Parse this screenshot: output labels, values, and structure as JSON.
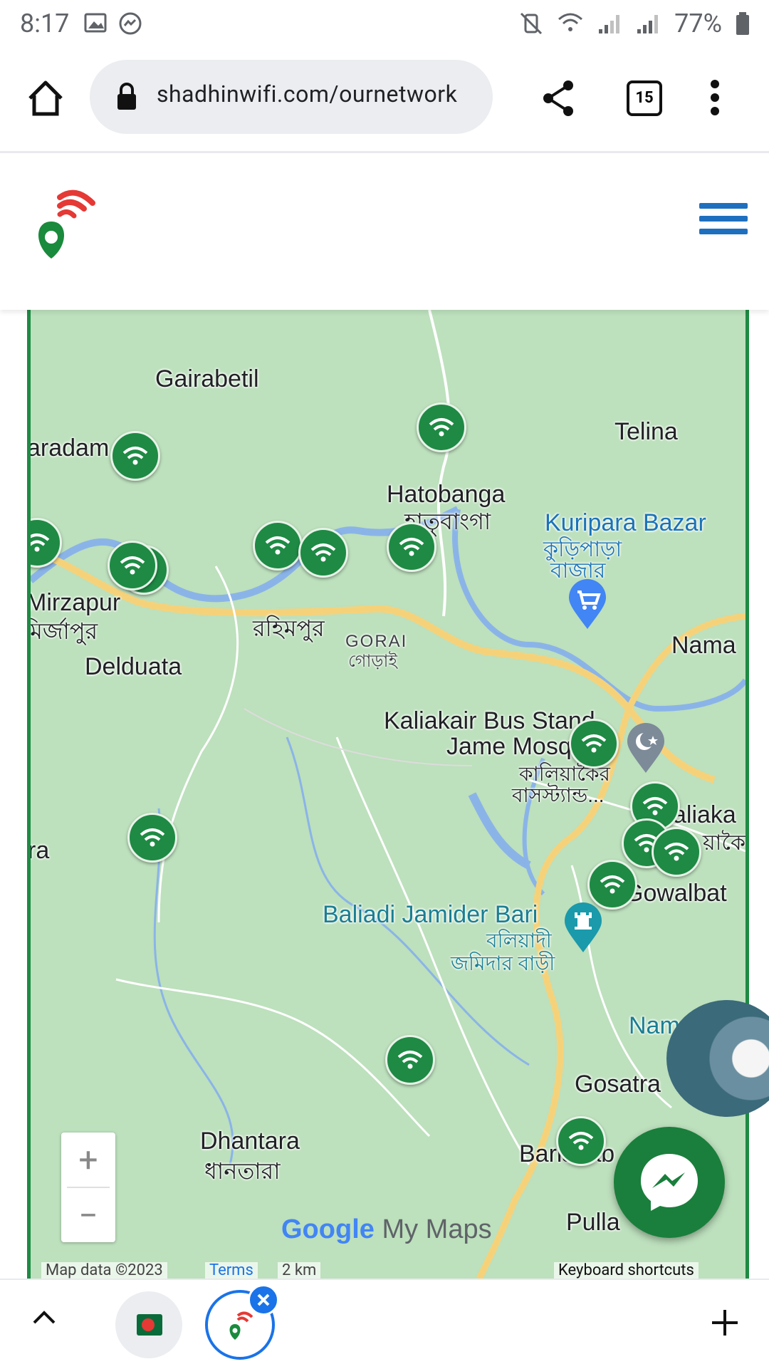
{
  "status_bar": {
    "time": "8:17",
    "battery": "77%"
  },
  "browser": {
    "url": "shadhinwifi.com/ournetwork",
    "tab_count": "15"
  },
  "map": {
    "places": [
      {
        "id": "gairabetil",
        "text": "Gairabetil",
        "style": "dark"
      },
      {
        "id": "telina",
        "text": "Telina",
        "style": "dark"
      },
      {
        "id": "aradam",
        "text": "aradam",
        "style": "dark"
      },
      {
        "id": "hatobanga",
        "text": "Hatobanga",
        "style": "dark"
      },
      {
        "id": "hatobanga_bn",
        "text": "হাতুবাংগা",
        "style": "dark"
      },
      {
        "id": "kuripara",
        "text": "Kuripara Bazar",
        "style": "blue"
      },
      {
        "id": "kuripara_bn1",
        "text": "কুড়িপাড়া",
        "style": "blue"
      },
      {
        "id": "kuripara_bn2",
        "text": "বাজার",
        "style": "blue"
      },
      {
        "id": "mirzapur",
        "text": "Mirzapur",
        "style": "dark"
      },
      {
        "id": "mirzapur_bn",
        "text": "মির্জাপুর",
        "style": "dark"
      },
      {
        "id": "rahimpur_bn",
        "text": "রহিমপুর",
        "style": "dark"
      },
      {
        "id": "goral",
        "text": "GORAI",
        "style": "small"
      },
      {
        "id": "goral_bn",
        "text": "গোড়াই",
        "style": "small"
      },
      {
        "id": "nama",
        "text": "Nama",
        "style": "dark"
      },
      {
        "id": "delduata",
        "text": "Delduata",
        "style": "dark"
      },
      {
        "id": "kaliakair1",
        "text": "Kaliakair Bus Stand",
        "style": "dark"
      },
      {
        "id": "kaliakair2",
        "text": "Jame Mosque",
        "style": "dark"
      },
      {
        "id": "kaliakair_bn1",
        "text": "কালিয়াকৈর",
        "style": "dark"
      },
      {
        "id": "kaliakair_bn2",
        "text": "বাসস্ট্যান্ড...",
        "style": "dark"
      },
      {
        "id": "kaliaka",
        "text": "aliaka",
        "style": "dark"
      },
      {
        "id": "kaliaka_bn",
        "text": "য়াকৈ",
        "style": "dark"
      },
      {
        "id": "ra",
        "text": "ra",
        "style": "dark"
      },
      {
        "id": "gowalbat",
        "text": "Gowalbat",
        "style": "dark"
      },
      {
        "id": "baliadi",
        "text": "Baliadi Jamider Bari",
        "style": "teal"
      },
      {
        "id": "baliadi_bn1",
        "text": "বলিয়াদী",
        "style": "teal"
      },
      {
        "id": "baliadi_bn2",
        "text": "জমিদার বাড়ী",
        "style": "teal"
      },
      {
        "id": "nam",
        "text": "Nam",
        "style": "teal"
      },
      {
        "id": "gosatra",
        "text": "Gosatra",
        "style": "dark"
      },
      {
        "id": "dhantara",
        "text": "Dhantara",
        "style": "dark"
      },
      {
        "id": "dhantara_bn",
        "text": "ধানতারা",
        "style": "dark"
      },
      {
        "id": "barishab",
        "text": "Barishab",
        "style": "dark"
      },
      {
        "id": "pulla",
        "text": "Pulla",
        "style": "dark"
      }
    ],
    "zoom_in": "+",
    "zoom_out": "−",
    "branding": {
      "google": "Google",
      "mymaps": "My Maps"
    },
    "footer": {
      "map_data": "Map data ©2023",
      "terms": "Terms",
      "scale": "2 km",
      "shortcuts": "Keyboard shortcuts"
    }
  },
  "colors": {
    "map_bg": "#bde0bd",
    "pin": "#1e8a44",
    "accent": "#1a73e8",
    "messenger": "#1a7f3c"
  }
}
